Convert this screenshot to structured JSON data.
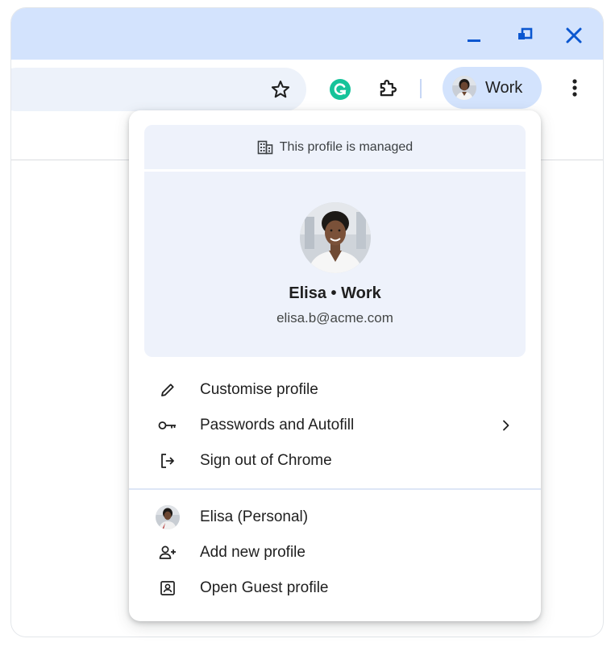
{
  "toolbar": {
    "profile_chip_label": "Work"
  },
  "menu": {
    "managed_notice": "This profile is managed",
    "identity": {
      "name": "Elisa • Work",
      "email": "elisa.b@acme.com"
    },
    "actions": [
      {
        "label": "Customise profile",
        "icon": "pencil-icon"
      },
      {
        "label": "Passwords and Autofill",
        "icon": "key-icon",
        "has_submenu": true
      },
      {
        "label": "Sign out of Chrome",
        "icon": "sign-out-icon"
      }
    ],
    "profiles": [
      {
        "label": "Elisa (Personal)",
        "icon": "avatar"
      },
      {
        "label": "Add new profile",
        "icon": "add-person-icon"
      },
      {
        "label": "Open Guest profile",
        "icon": "guest-icon"
      }
    ]
  },
  "colors": {
    "titlebar": "#d3e3fd",
    "omnibox": "#edf2fa",
    "profile_chip": "#d3e3fd",
    "accent_blue": "#0b57d0",
    "grammarly_green": "#15c39a",
    "menu_header_bg": "#eef2fb"
  }
}
